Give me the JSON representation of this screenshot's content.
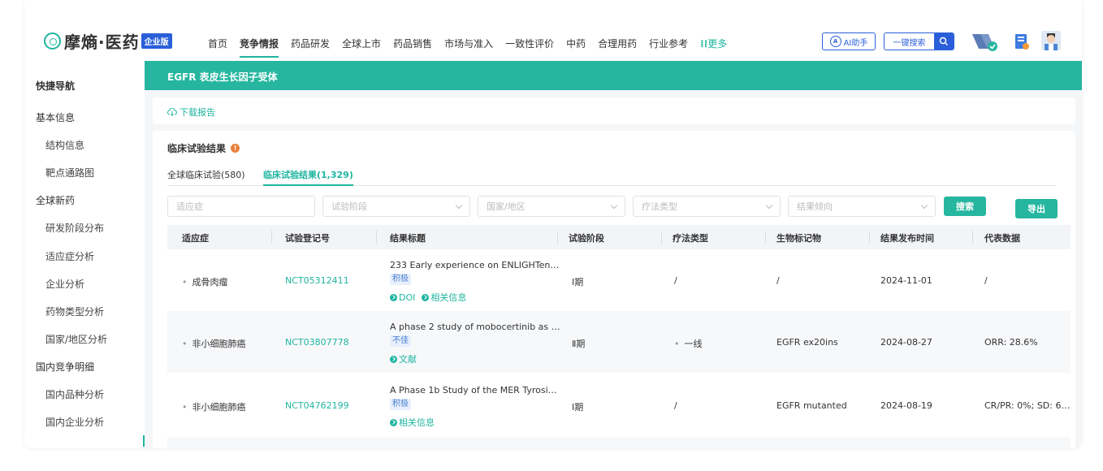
{
  "brand": {
    "name": "摩熵·医药",
    "badge": "企业版"
  },
  "nav": {
    "items": [
      "首页",
      "竞争情报",
      "药品研发",
      "全球上市",
      "药品销售",
      "市场与准入",
      "一致性评价",
      "中药",
      "合理用药",
      "行业参考"
    ],
    "active_index": 1,
    "more_label": "更多",
    "ai_label": "AI助手",
    "search_label": "一键搜索"
  },
  "sidebar": {
    "items": [
      {
        "label": "快捷导航",
        "level": "head"
      },
      {
        "label": "基本信息",
        "level": "group"
      },
      {
        "label": "结构信息",
        "level": "sub"
      },
      {
        "label": "靶点通路图",
        "level": "sub"
      },
      {
        "label": "全球新药",
        "level": "group"
      },
      {
        "label": "研发阶段分布",
        "level": "sub"
      },
      {
        "label": "适应症分析",
        "level": "sub"
      },
      {
        "label": "企业分析",
        "level": "sub"
      },
      {
        "label": "药物类型分析",
        "level": "sub"
      },
      {
        "label": "国家/地区分析",
        "level": "sub"
      },
      {
        "label": "国内竞争明细",
        "level": "group"
      },
      {
        "label": "国内品种分析",
        "level": "sub"
      },
      {
        "label": "国内企业分析",
        "level": "sub"
      }
    ]
  },
  "banner": {
    "title": "EGFR  表皮生长因子受体"
  },
  "download_label": "下载报告",
  "section": {
    "title": "临床试验结果",
    "tabs": [
      {
        "label": "全球临床试验(580)",
        "active": false
      },
      {
        "label": "临床试验结果(1,329)",
        "active": true
      }
    ]
  },
  "filters": {
    "indication": "适应症",
    "phase": "试验阶段",
    "region": "国家/地区",
    "therapy": "疗法类型",
    "trend": "结果倾向",
    "search_button": "搜索",
    "export_button": "导出"
  },
  "table": {
    "columns": [
      "适应症",
      "试验登记号",
      "结果标题",
      "试验阶段",
      "疗法类型",
      "生物标记物",
      "结果发布时间",
      "代表数据"
    ],
    "rows": [
      {
        "indication": "成骨肉瘤",
        "reg_no": "NCT05312411",
        "title": "233 Early experience on ENLIGHTen…",
        "tag": "积极",
        "links": [
          "DOI",
          "相关信息"
        ],
        "phase": "Ⅰ期",
        "therapy": "/",
        "biomarker": "/",
        "date": "2024-11-01",
        "data": "/"
      },
      {
        "indication": "非小细胞肺癌",
        "reg_no": "NCT03807778",
        "title": "A phase 2 study of mobocertinib as …",
        "tag": "不佳",
        "links": [
          "文献"
        ],
        "phase": "Ⅱ期",
        "therapy": "一线",
        "biomarker": "EGFR ex20ins",
        "date": "2024-08-27",
        "data": "ORR: 28.6%"
      },
      {
        "indication": "非小细胞肺癌",
        "reg_no": "NCT04762199",
        "title": "A Phase 1b Study of the MER Tyrosi…",
        "tag": "积极",
        "links": [
          "相关信息"
        ],
        "phase": "Ⅰ期",
        "therapy": "/",
        "biomarker": "EGFR mutanted",
        "date": "2024-08-19",
        "data": "CR/PR: 0%; SD: 6…"
      }
    ]
  },
  "colors": {
    "accent": "#26b6a0",
    "brand_blue": "#2a5fd9"
  }
}
